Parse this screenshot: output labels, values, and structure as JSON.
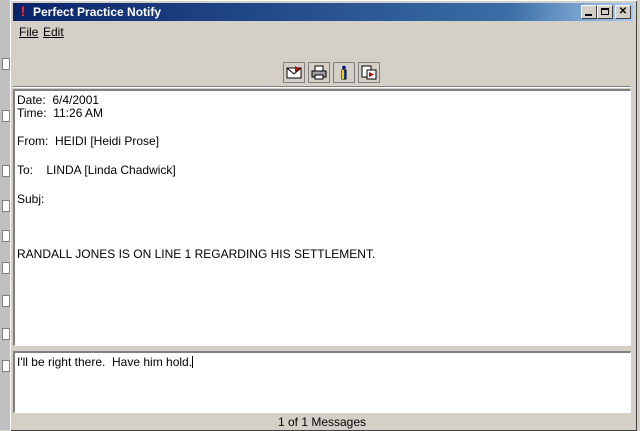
{
  "window": {
    "title": "Perfect Practice Notify"
  },
  "menu": {
    "file": "File",
    "edit": "Edit"
  },
  "toolbar": {
    "buttons": [
      {
        "icon": "reply-icon"
      },
      {
        "icon": "print-icon"
      },
      {
        "icon": "info-icon"
      },
      {
        "icon": "forward-icon"
      }
    ]
  },
  "message": {
    "date": "Date:  6/4/2001",
    "time": "Time:  11:26 AM",
    "from": "From:  HEIDI [Heidi Prose]",
    "to": "To:    LINDA [Linda Chadwick]",
    "subj": "Subj:",
    "body": "RANDALL JONES IS ON LINE 1 REGARDING HIS SETTLEMENT."
  },
  "reply": {
    "text": "I'll be right there.  Have him hold."
  },
  "status": {
    "text": "1 of 1 Messages"
  }
}
